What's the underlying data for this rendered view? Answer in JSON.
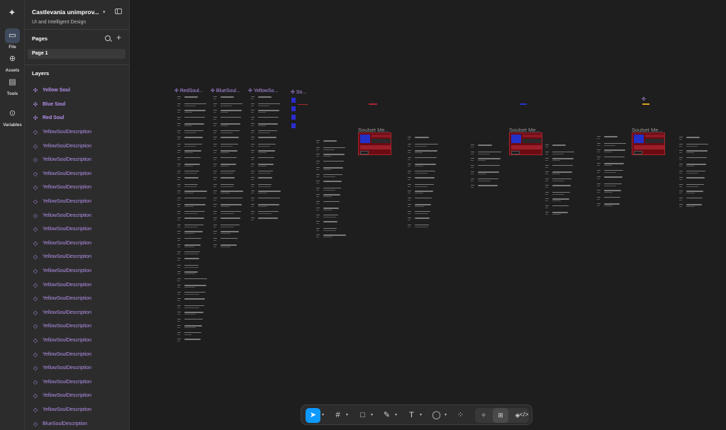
{
  "file": {
    "title": "Castlevania unimprov...",
    "subtitle": "UI and Intelligent Design"
  },
  "rail": {
    "file_label": "File",
    "assets_label": "Assets",
    "tools_label": "Tools",
    "variables_label": "Variables"
  },
  "pages": {
    "title": "Pages",
    "items": [
      "Page 1"
    ]
  },
  "layers": {
    "title": "Layers",
    "items": [
      {
        "label": "Yellow Soul",
        "kind": "component"
      },
      {
        "label": "Blue Soul",
        "kind": "component"
      },
      {
        "label": "Red Soul",
        "kind": "component"
      },
      {
        "label": "YellowSoulDescription",
        "kind": "instance"
      },
      {
        "label": "YellowSoulDescription",
        "kind": "instance"
      },
      {
        "label": "YellowSoulDescription",
        "kind": "instance"
      },
      {
        "label": "YellowSoulDescription",
        "kind": "instance"
      },
      {
        "label": "YellowSoulDescription",
        "kind": "instance"
      },
      {
        "label": "YellowSoulDescription",
        "kind": "instance"
      },
      {
        "label": "YellowSoulDescription",
        "kind": "instance"
      },
      {
        "label": "YellowSoulDescription",
        "kind": "instance"
      },
      {
        "label": "YellowSoulDescription",
        "kind": "instance"
      },
      {
        "label": "YellowSoulDescription",
        "kind": "instance"
      },
      {
        "label": "YellowSoulDescription",
        "kind": "instance"
      },
      {
        "label": "YellowSoulDescription",
        "kind": "instance"
      },
      {
        "label": "YellowSoulDescription",
        "kind": "instance"
      },
      {
        "label": "YellowSoulDescription",
        "kind": "instance"
      },
      {
        "label": "YellowSoulDescription",
        "kind": "instance"
      },
      {
        "label": "YellowSoulDescription",
        "kind": "instance"
      },
      {
        "label": "YellowSoulDescription",
        "kind": "instance"
      },
      {
        "label": "YellowSoulDescription",
        "kind": "instance"
      },
      {
        "label": "YellowSoulDescription",
        "kind": "instance"
      },
      {
        "label": "YellowSoulDescription",
        "kind": "instance"
      },
      {
        "label": "YellowSoulDescription",
        "kind": "instance"
      },
      {
        "label": "BlueSoulDescription",
        "kind": "instance"
      },
      {
        "label": "BlueSoulDescription",
        "kind": "instance"
      }
    ]
  },
  "canvas": {
    "frames": [
      {
        "label": "RedSoul..."
      },
      {
        "label": "BlueSoul..."
      },
      {
        "label": "YellowSo..."
      },
      {
        "label": "So..."
      }
    ],
    "meters": [
      {
        "label": "Soulset Me..."
      },
      {
        "label": "Soulset Me..."
      },
      {
        "label": "Soulset Me..."
      }
    ]
  },
  "toolbar": {
    "tools": [
      "move",
      "frame",
      "shape",
      "pen",
      "text",
      "comment",
      "actions"
    ],
    "active_tool": "move"
  },
  "colors": {
    "accent": "#0d99ff",
    "component": "#b591ee",
    "sidebar_bg": "#2c2c2c",
    "canvas_bg": "#1e1e1e"
  }
}
